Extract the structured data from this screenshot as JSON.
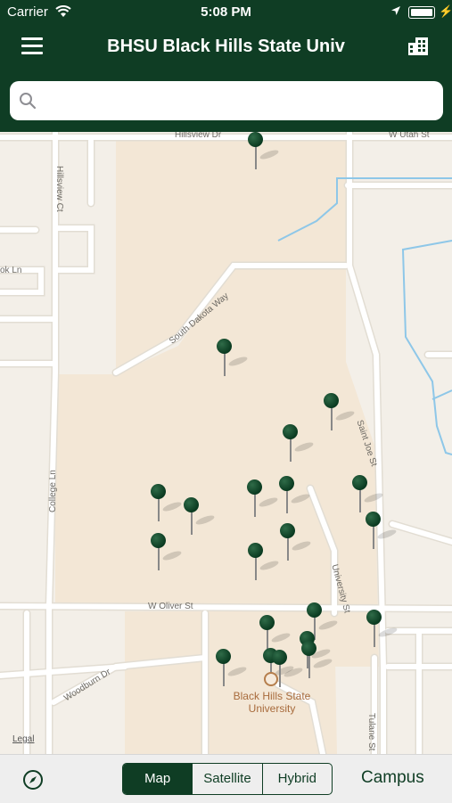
{
  "status_bar": {
    "carrier": "Carrier",
    "time": "5:08 PM"
  },
  "nav": {
    "title": "BHSU Black Hills State Univ"
  },
  "search": {
    "placeholder": ""
  },
  "map": {
    "streets": {
      "hillsview_dr": "Hillsview Dr",
      "w_utah_st": "W Utah St",
      "hillsview_ct": "Hillsview Ct",
      "ok_ln": "ok Ln",
      "south_dakota_way": "South Dakota Way",
      "saint_joe_st": "Saint Joe St",
      "college_ln": "College Ln",
      "university_st": "University St",
      "w_oliver_st": "W Oliver St",
      "woodburn_dr": "Woodburn Dr",
      "tulane_st": "Tulane St"
    },
    "poi_label": "Black Hills State University",
    "legal": "Legal"
  },
  "toolbar": {
    "segments": [
      "Map",
      "Satellite",
      "Hybrid"
    ],
    "selected": "Map",
    "campus": "Campus"
  },
  "colors": {
    "brand_green": "#0f3d24",
    "campus_fill": "#f3e7d6",
    "map_background": "#f3efe8",
    "water": "#8ec7e8"
  }
}
